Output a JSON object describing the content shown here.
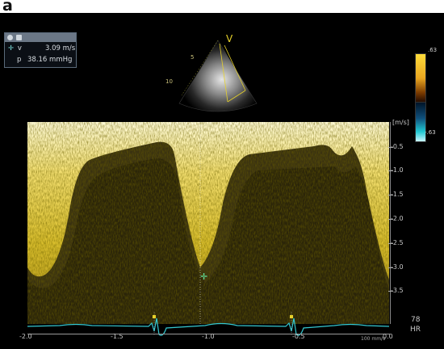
{
  "figure_letter": "a",
  "measurement": {
    "v_label": "v",
    "v_value": "3.09 m/s",
    "p_label": "p",
    "p_value": "38.16 mmHg"
  },
  "echo": {
    "sector_label": "V",
    "depth_marks": [
      "5",
      "10"
    ]
  },
  "color_scale": {
    "top": ".63",
    "bottom": "-.63"
  },
  "velocity_axis": {
    "unit": "[m/s]",
    "ticks": [
      "-0.5",
      "-1.0",
      "-1.5",
      "-2.0",
      "-2.5",
      "-3.0",
      "-3.5"
    ]
  },
  "time_axis": {
    "ticks": [
      "-2.0",
      "-1.5",
      "-1.0",
      "-0.5",
      "0.0"
    ],
    "speed": "100 mm/s"
  },
  "heart_rate": {
    "value": "78",
    "label": "HR"
  },
  "colors": {
    "spectral_bright": "#fff6b0",
    "spectral_yellow": "#d9c234",
    "spectral_dark": "#1c1808",
    "ecg": "#35c8d0",
    "caliper": "#e6d12a"
  }
}
